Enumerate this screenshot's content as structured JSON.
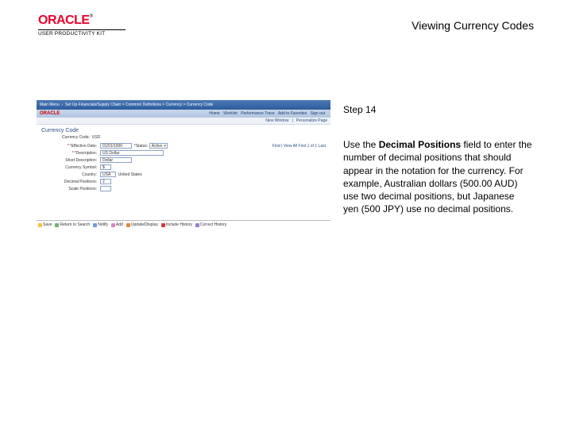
{
  "header": {
    "brand": "ORACLE",
    "tm": "®",
    "product_line": "USER PRODUCTIVITY KIT",
    "title": "Viewing Currency Codes"
  },
  "right": {
    "step": "Step 14",
    "instr_pre": "Use the ",
    "instr_bold": "Decimal Positions",
    "instr_post": " field to enter the number of decimal positions that should appear in the notation for the currency. For example, Australian dollars (500.00 AUD) use two decimal positions, but Japanese yen (500 JPY) use no decimal positions."
  },
  "shot": {
    "topbar_left": "Main Menu",
    "topbar_breadcrumb": "Set Up Financials/Supply Chain > Common Definitions > Currency > Currency Code",
    "topright": {
      "home": "Home",
      "worklist": "Worklist",
      "perf": "Performance Trace",
      "add": "Add to Favorites",
      "signout": "Sign out"
    },
    "small_logo": "ORACLE",
    "sub2": {
      "newwin": "New Window",
      "pers": "Personalize Page"
    },
    "page_title": "Currency Code",
    "code_label": "Currency Code:",
    "code_value": "USD",
    "form": {
      "eff_lbl": "*Effective Date:",
      "eff_val": "01/01/1900",
      "stat_lbl": "*Status:",
      "stat_val": "Active",
      "findrow": "Find | View All   First  1 of 1  Last",
      "desc_lbl": "*Description:",
      "desc_val": "US Dollar",
      "short_lbl": "Short Description:",
      "short_val": "Dollar",
      "sym_lbl": "Currency Symbol:",
      "sym_val": "$",
      "ctry_lbl": "Country:",
      "ctry_code": "USA",
      "ctry_name": "United States",
      "dec_lbl": "Decimal Positions:",
      "dec_val": "2",
      "scale_lbl": "Scale Positions:"
    },
    "bottom": {
      "save": "Save",
      "return": "Return to Search",
      "notify": "Notify",
      "add": "Add",
      "upd": "Update/Display",
      "hist": "Include History",
      "corr": "Correct History"
    }
  }
}
